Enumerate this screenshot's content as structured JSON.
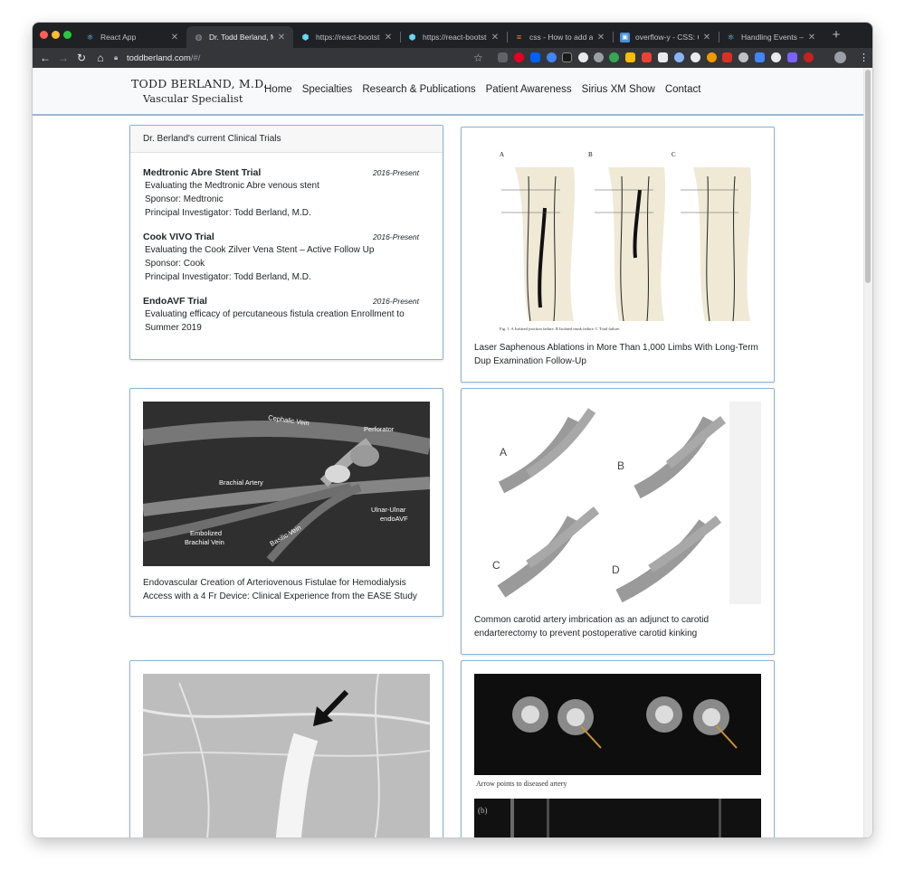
{
  "browser": {
    "tabs": [
      {
        "title": "React App",
        "icon": "react-icon",
        "active": false
      },
      {
        "title": "Dr. Todd Berland, M.D.",
        "icon": "globe-icon",
        "active": true
      },
      {
        "title": "https://react-bootstrap",
        "icon": "react-bootstrap-icon",
        "active": false
      },
      {
        "title": "https://react-bootstrap",
        "icon": "react-bootstrap-icon",
        "active": false
      },
      {
        "title": "css - How to add a s",
        "icon": "stackoverflow-icon",
        "active": false
      },
      {
        "title": "overflow-y - CSS: Ca",
        "icon": "box-icon",
        "active": false
      },
      {
        "title": "Handling Events – Re",
        "icon": "react-icon",
        "active": false
      }
    ],
    "url_host": "toddberland.com",
    "url_path": "/#/"
  },
  "site": {
    "brand_name": "TODD BERLAND, M.D.",
    "brand_sub": "Vascular Specialist",
    "nav": [
      "Home",
      "Specialties",
      "Research & Publications",
      "Patient Awareness",
      "Sirius XM Show",
      "Contact"
    ]
  },
  "trials": {
    "header": "Dr. Berland's current Clinical Trials",
    "items": [
      {
        "name": "Medtronic Abre Stent Trial",
        "date": "2016-Present",
        "lines": [
          "Evaluating the Medtronic Abre venous stent",
          "Sponsor: Medtronic",
          "Principal Investigator: Todd Berland, M.D."
        ]
      },
      {
        "name": "Cook VIVO Trial",
        "date": "2016-Present",
        "lines": [
          "Evaluating the Cook Zilver Vena Stent – Active Follow Up",
          "Sponsor: Cook",
          "Principal Investigator: Todd Berland, M.D."
        ]
      },
      {
        "name": "EndoAVF Trial",
        "date": "2016-Present",
        "lines": [
          "Evaluating efficacy of percutaneous fistula creation Enrollment to",
          "Summer 2019"
        ]
      }
    ]
  },
  "publications": [
    {
      "caption": "Laser Saphenous Ablations in More Than 1,000 Limbs With Long-Term Dup Examination Follow-Up",
      "figure_labels": [
        "A",
        "B",
        "C"
      ],
      "figure_note": "Fig. 1. A Isolated junction failure. B Isolated trunk failure. C Total failure."
    },
    {
      "caption": "Endovascular Creation of Arteriovenous Fistulae for Hemodialysis Access with a 4 Fr Device: Clinical Experience from the EASE Study",
      "figure_labels": [
        "Cephalic Vein",
        "Perforator",
        "Brachial Artery",
        "Ulnar-Ulnar",
        "endoAVF",
        "Embolized",
        "Brachial Vein",
        "Basilic Vein"
      ]
    },
    {
      "caption": "Common carotid artery imbrication as an adjunct to carotid endarterectomy to prevent postoperative carotid kinking",
      "figure_labels": [
        "A",
        "B",
        "C",
        "D"
      ]
    },
    {
      "caption": "",
      "figure_labels": []
    },
    {
      "caption": "",
      "figure_labels": [
        "Arrow points to diseased artery",
        "(b)"
      ]
    }
  ],
  "colors": {
    "card_border": "#8fb3d0",
    "nav_bg": "#f8f9fa",
    "chrome_dark": "#202124"
  }
}
